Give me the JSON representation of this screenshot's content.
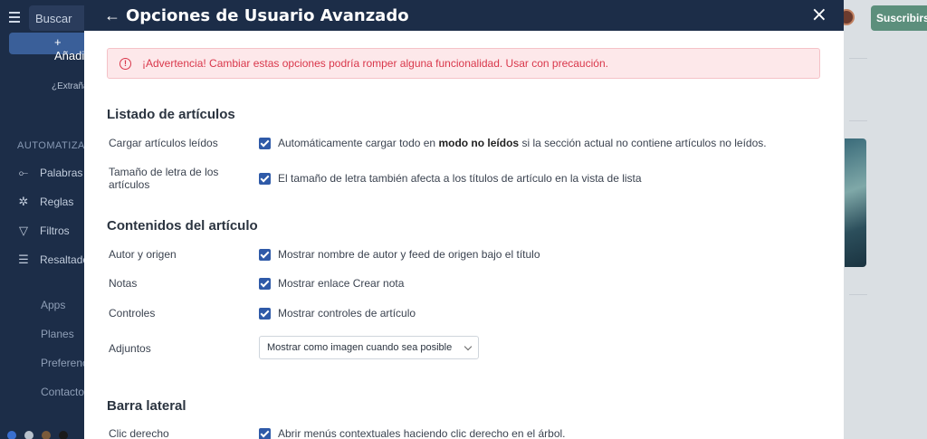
{
  "app": {
    "search_placeholder": "Buscar",
    "add_label": "Añadir",
    "strange_text": "¿Extraña",
    "automation_title": "AUTOMATIZACIÓN",
    "nav": [
      {
        "label": "Palabras",
        "icon": "keyword-icon"
      },
      {
        "label": "Reglas",
        "icon": "rules-icon"
      },
      {
        "label": "Filtros",
        "icon": "filter-icon"
      },
      {
        "label": "Resaltado",
        "icon": "highlight-icon"
      }
    ],
    "footer": [
      "Apps",
      "Planes",
      "Preferencias",
      "Contacto"
    ],
    "subscribe_label": "Suscribirse"
  },
  "modal": {
    "title": "Opciones de Usuario Avanzado",
    "warning": "¡Advertencia! Cambiar estas opciones podría romper alguna funcionalidad. Usar con precaución.",
    "sections": {
      "list": {
        "title": "Listado de artículos",
        "rows": [
          {
            "label": "Cargar artículos leídos",
            "checked": true,
            "desc_pre": "Automáticamente cargar todo en ",
            "desc_bold": "modo no leídos",
            "desc_post": " si la sección actual no contiene artículos no leídos."
          },
          {
            "label": "Tamaño de letra de los artículos",
            "checked": true,
            "desc": "El tamaño de letra también afecta a los títulos de artículo en la vista de lista"
          }
        ]
      },
      "content": {
        "title": "Contenidos del artículo",
        "rows": [
          {
            "label": "Autor y origen",
            "checked": true,
            "desc": "Mostrar nombre de autor y feed de origen bajo el título"
          },
          {
            "label": "Notas",
            "checked": true,
            "desc": "Mostrar enlace Crear nota"
          },
          {
            "label": "Controles",
            "checked": true,
            "desc": "Mostrar controles de artículo"
          }
        ],
        "attachments": {
          "label": "Adjuntos",
          "selected": "Mostrar como imagen cuando sea posible"
        }
      },
      "sidebar": {
        "title": "Barra lateral",
        "rows": [
          {
            "label": "Clic derecho",
            "checked": true,
            "desc": "Abrir menús contextuales haciendo clic derecho en el árbol."
          }
        ]
      }
    }
  },
  "colors": {
    "accent": "#2f5aa8",
    "header": "#1c2d48",
    "warning": "#d9374b",
    "subscribe": "#5c8f7c"
  }
}
